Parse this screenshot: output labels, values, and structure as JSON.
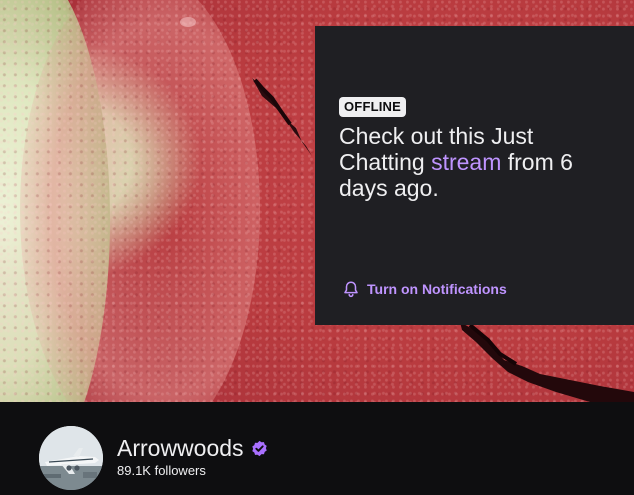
{
  "offline_card": {
    "badge": "OFFLINE",
    "message_before": "Check out this Just Chatting ",
    "message_link": "stream",
    "message_after": " from 6 days ago.",
    "notification_label": "Turn on Notifications"
  },
  "channel": {
    "name": "Arrowwoods",
    "followers": "89.1K followers",
    "verified": true
  },
  "colors": {
    "accent": "#bf94ff",
    "card_bg": "#1f1f23",
    "page_bg": "#0e0e10",
    "text": "#efeff1",
    "verified": "#a970ff"
  },
  "icons": {
    "notification": "bell-icon",
    "verified": "verified-badge-icon"
  }
}
